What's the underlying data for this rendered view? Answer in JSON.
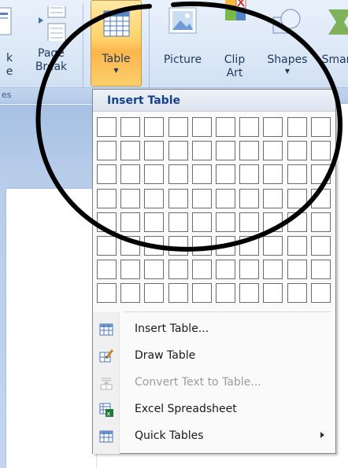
{
  "ribbon": {
    "buttons": [
      {
        "id": "cover",
        "label_line1": "k",
        "label_line2": "e"
      },
      {
        "id": "page-break",
        "label_line1": "Page",
        "label_line2": "Break"
      },
      {
        "id": "table",
        "label_line1": "Table",
        "label_line2": ""
      },
      {
        "id": "picture",
        "label_line1": "Picture",
        "label_line2": ""
      },
      {
        "id": "clip-art",
        "label_line1": "Clip",
        "label_line2": "Art"
      },
      {
        "id": "shapes",
        "label_line1": "Shapes",
        "label_line2": ""
      },
      {
        "id": "smartart",
        "label_line1": "Smar",
        "label_line2": ""
      }
    ],
    "group_label_fragment": "es"
  },
  "menu": {
    "header": "Insert Table",
    "grid": {
      "columns": 10,
      "rows": 8
    },
    "items": [
      {
        "label": "Insert Table...",
        "icon": "table-grid-icon",
        "disabled": false,
        "has_submenu": false
      },
      {
        "label": "Draw Table",
        "icon": "pencil-table-icon",
        "disabled": false,
        "has_submenu": false
      },
      {
        "label": "Convert Text to Table...",
        "icon": "convert-text-icon",
        "disabled": true,
        "has_submenu": false
      },
      {
        "label": "Excel Spreadsheet",
        "icon": "excel-sheet-icon",
        "disabled": false,
        "has_submenu": false
      },
      {
        "label": "Quick Tables",
        "icon": "quick-table-icon",
        "disabled": false,
        "has_submenu": true
      }
    ]
  },
  "colors": {
    "ribbon_text": "#1e395b",
    "menu_header_text": "#15428b",
    "active_button": "#fdb54d",
    "annotation_stroke": "#000000"
  }
}
